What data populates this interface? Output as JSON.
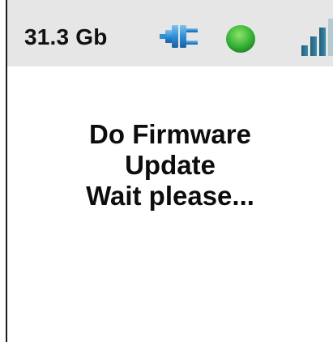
{
  "status_bar": {
    "data_usage": "31.3 Gb",
    "plug_icon": "plug-icon",
    "status_dot": "status-indicator-dot",
    "status_dot_color": "#3db83a",
    "signal_icon": "signal-strength-icon",
    "signal_color": "#2e6f8a"
  },
  "message": {
    "line1": "Do Firmware",
    "line2": "Update",
    "line3": "Wait please..."
  }
}
